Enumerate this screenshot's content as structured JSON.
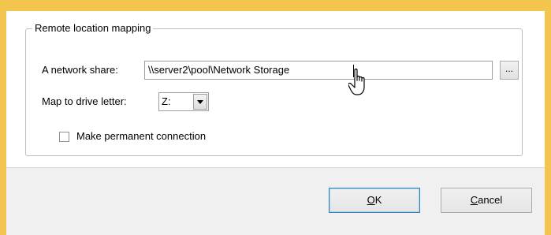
{
  "group": {
    "legend": "Remote location mapping"
  },
  "network_share": {
    "label": "A network share:",
    "value": "\\\\server2\\pool\\Network Storage",
    "browse_label": "..."
  },
  "drive_letter": {
    "label": "Map to drive letter:",
    "selected": "Z:"
  },
  "permanent": {
    "label": "Make permanent connection",
    "checked": false
  },
  "buttons": {
    "ok": {
      "accel": "O",
      "rest": "K"
    },
    "cancel": {
      "accel": "C",
      "rest": "ancel"
    }
  },
  "icons": {
    "cursor": "hand-pointer-icon",
    "dropdown": "chevron-down-icon"
  }
}
